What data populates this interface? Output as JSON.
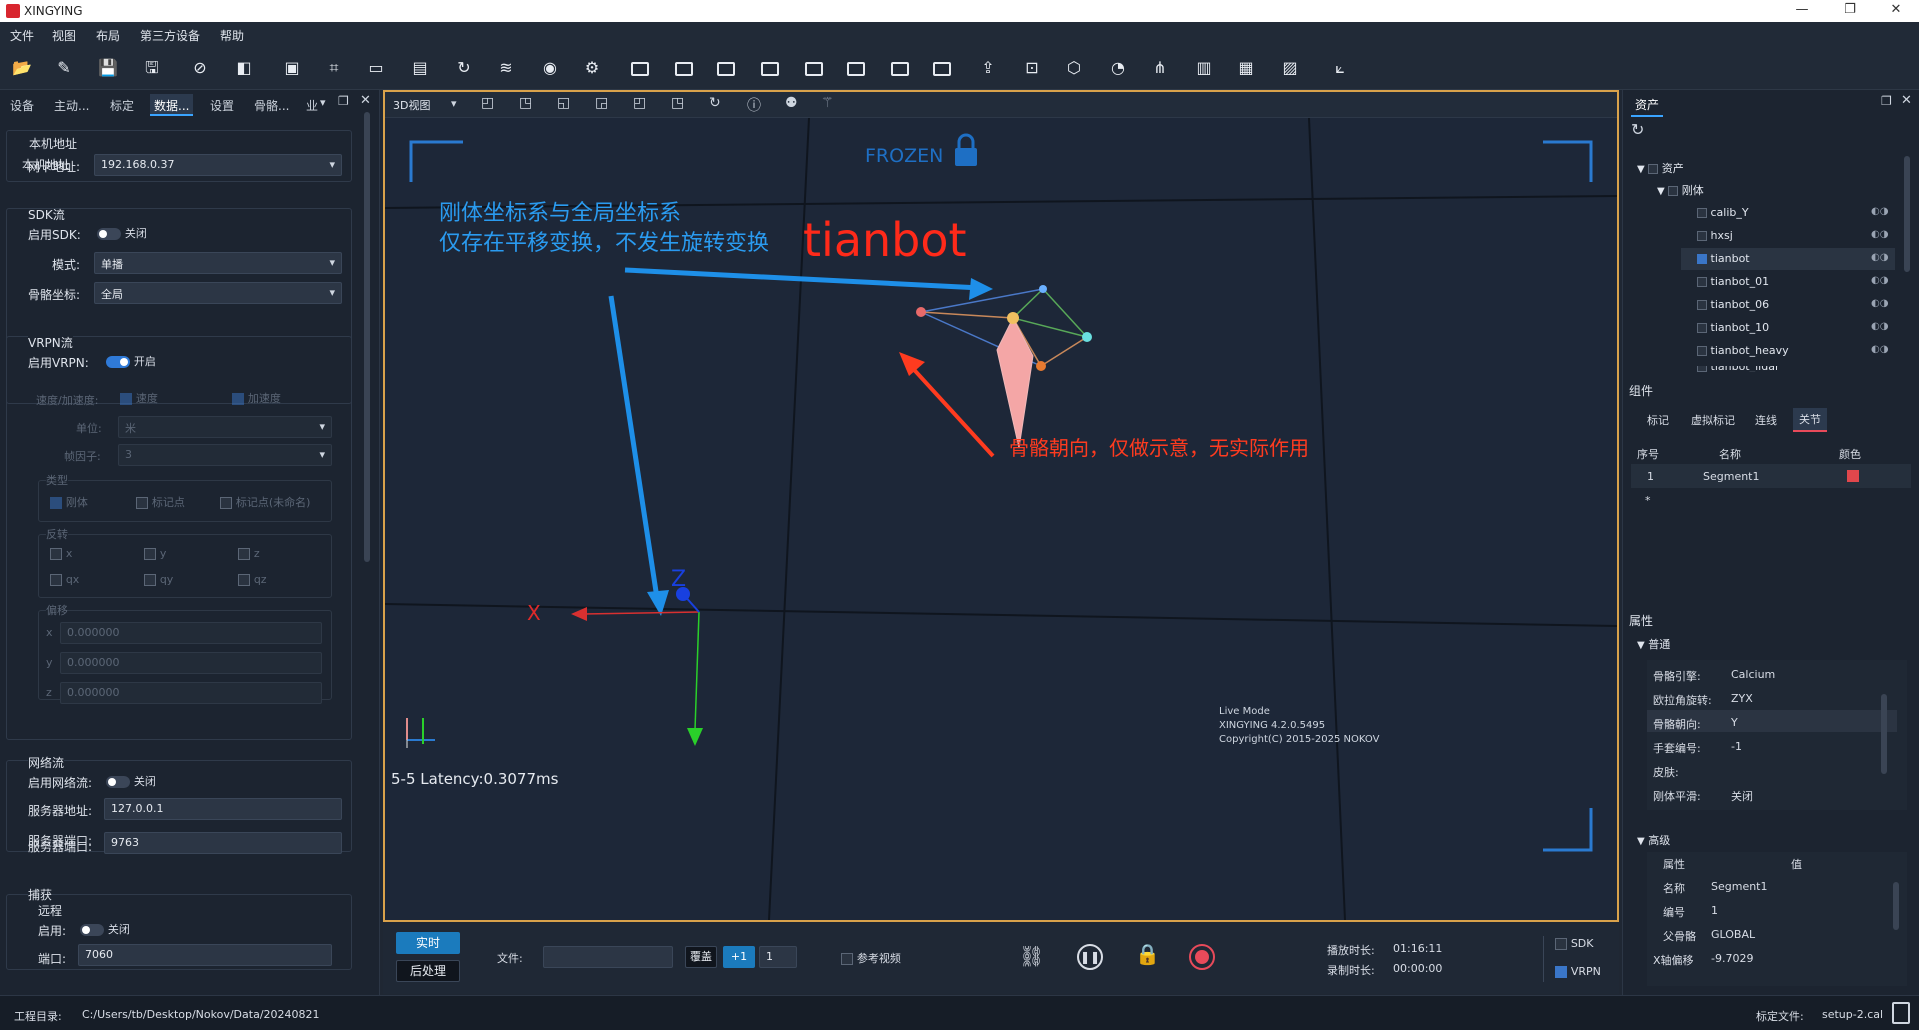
{
  "app": {
    "title": "XINGYING",
    "window_buttons": [
      "—",
      "❐",
      "✕"
    ]
  },
  "menu": [
    "文件",
    "视图",
    "布局",
    "第三方设备",
    "帮助"
  ],
  "left_tabs": [
    "设备",
    "主动...",
    "标定",
    "数据...",
    "设置",
    "骨骼...",
    "业"
  ],
  "left": {
    "local_addr_title": "本机地址",
    "nic_label": "网卡地址:",
    "nic_value": "192.168.0.37",
    "sdk_title": "SDK流",
    "sdk_enable_label": "启用SDK:",
    "sdk_enable_state": "关闭",
    "mode_label": "模式:",
    "mode_value": "单播",
    "skel_coord_label": "骨骼坐标:",
    "skel_coord_value": "全局",
    "vrpn_title": "VRPN流",
    "vrpn_enable_label": "启用VRPN:",
    "vrpn_enable_state": "开启",
    "speed_label": "速度/加速度:",
    "speed_cb": "速度",
    "accel_cb": "加速度",
    "unit_label": "单位:",
    "unit_value": "米",
    "frame_label": "帧因子:",
    "frame_value": "3",
    "type_title": "类型",
    "type_rigid": "刚体",
    "type_marker": "标记点",
    "type_unnamed": "标记点(未命名)",
    "invert_title": "反转",
    "inv": [
      "x",
      "y",
      "z",
      "qx",
      "qy",
      "qz"
    ],
    "offset_title": "偏移",
    "off_labels": [
      "x",
      "y",
      "z"
    ],
    "off_values": [
      "0.000000",
      "0.000000",
      "0.000000"
    ],
    "net_title": "网络流",
    "net_enable_label": "启用网络流:",
    "net_enable_state": "关闭",
    "server_addr_label": "服务器地址:",
    "server_addr_value": "127.0.0.1",
    "server_port_label": "服务器端口:",
    "server_port_value": "9763",
    "capture_title": "捕获",
    "remote_title": "远程",
    "remote_enable_label": "启用:",
    "remote_enable_state": "关闭",
    "port_label": "端口:",
    "port_value": "7060"
  },
  "viewport": {
    "view_select": "3D视图",
    "frozen": "FROZEN",
    "anno_line1": "刚体坐标系与全局坐标系",
    "anno_line2": "仅存在平移变换，不发生旋转变换",
    "rigid_name": "tianbot",
    "anno_bone": "骨骼朝向，仅做示意，无实际作用",
    "axis_x": "X",
    "axis_z": "Z",
    "latency": "5-5 Latency:0.3077ms",
    "live_mode": "Live Mode",
    "version": "XINGYING 4.2.0.5495",
    "copyright": "Copyright(C) 2015-2025 NOKOV",
    "colors": {
      "bone": "#f4a6a6",
      "arrow": "#1e8fe8",
      "red_anno": "#ff3b1f"
    }
  },
  "bottom": {
    "realtime": "实时",
    "post": "后处理",
    "file_label": "文件:",
    "file_value": "",
    "overwrite": "覆盖",
    "plus1": "+1",
    "step": "1",
    "ref_video": "参考视频",
    "play_label": "播放时长:",
    "play_value": "01:16:11",
    "rec_label": "录制时长:",
    "rec_value": "00:00:00",
    "sdk": "SDK",
    "vrpn": "VRPN"
  },
  "right": {
    "assets_tab": "资产",
    "tree": {
      "root": "资产",
      "rigid": "刚体",
      "items": [
        "calib_Y",
        "hxsj",
        "tianbot",
        "tianbot_01",
        "tianbot_06",
        "tianbot_10",
        "tianbot_heavy",
        "tianbot_lidar"
      ],
      "checked": "tianbot"
    },
    "components_title": "组件",
    "comp_tabs": [
      "标记",
      "虚拟标记",
      "连线",
      "关节"
    ],
    "comp_cols": [
      "序号",
      "名称",
      "颜色"
    ],
    "comp_row": {
      "idx": "1",
      "name": "Segment1",
      "color": "#e0474c"
    },
    "comp_star": "*",
    "props_title": "属性",
    "general_title": "普通",
    "general": [
      {
        "k": "骨骼引擎:",
        "v": "Calcium"
      },
      {
        "k": "欧拉角旋转:",
        "v": "ZYX"
      },
      {
        "k": "骨骼朝向:",
        "v": "Y"
      },
      {
        "k": "手套编号:",
        "v": "-1"
      },
      {
        "k": "皮肤:",
        "v": ""
      },
      {
        "k": "刚体平滑:",
        "v": "关闭"
      }
    ],
    "advanced_title": "高级",
    "adv_cols": [
      "属性",
      "值"
    ],
    "advanced": [
      {
        "k": "名称",
        "v": "Segment1"
      },
      {
        "k": "编号",
        "v": "1"
      },
      {
        "k": "父骨骼",
        "v": "GLOBAL"
      },
      {
        "k": "X轴偏移",
        "v": "-9.7029"
      }
    ]
  },
  "status": {
    "proj_label": "工程目录:",
    "proj_path": "C:/Users/tb/Desktop/Nokov/Data/20240821",
    "calib_label": "标定文件:",
    "calib_file": "setup-2.cal"
  }
}
